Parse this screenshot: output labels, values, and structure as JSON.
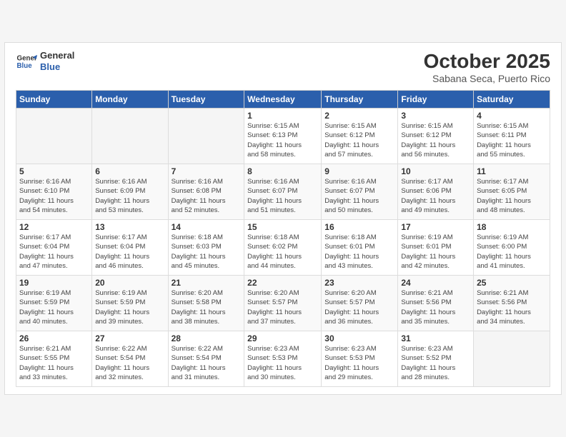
{
  "header": {
    "logo_line1": "General",
    "logo_line2": "Blue",
    "month": "October 2025",
    "location": "Sabana Seca, Puerto Rico"
  },
  "weekdays": [
    "Sunday",
    "Monday",
    "Tuesday",
    "Wednesday",
    "Thursday",
    "Friday",
    "Saturday"
  ],
  "weeks": [
    [
      {
        "day": "",
        "info": ""
      },
      {
        "day": "",
        "info": ""
      },
      {
        "day": "",
        "info": ""
      },
      {
        "day": "1",
        "info": "Sunrise: 6:15 AM\nSunset: 6:13 PM\nDaylight: 11 hours\nand 58 minutes."
      },
      {
        "day": "2",
        "info": "Sunrise: 6:15 AM\nSunset: 6:12 PM\nDaylight: 11 hours\nand 57 minutes."
      },
      {
        "day": "3",
        "info": "Sunrise: 6:15 AM\nSunset: 6:12 PM\nDaylight: 11 hours\nand 56 minutes."
      },
      {
        "day": "4",
        "info": "Sunrise: 6:15 AM\nSunset: 6:11 PM\nDaylight: 11 hours\nand 55 minutes."
      }
    ],
    [
      {
        "day": "5",
        "info": "Sunrise: 6:16 AM\nSunset: 6:10 PM\nDaylight: 11 hours\nand 54 minutes."
      },
      {
        "day": "6",
        "info": "Sunrise: 6:16 AM\nSunset: 6:09 PM\nDaylight: 11 hours\nand 53 minutes."
      },
      {
        "day": "7",
        "info": "Sunrise: 6:16 AM\nSunset: 6:08 PM\nDaylight: 11 hours\nand 52 minutes."
      },
      {
        "day": "8",
        "info": "Sunrise: 6:16 AM\nSunset: 6:07 PM\nDaylight: 11 hours\nand 51 minutes."
      },
      {
        "day": "9",
        "info": "Sunrise: 6:16 AM\nSunset: 6:07 PM\nDaylight: 11 hours\nand 50 minutes."
      },
      {
        "day": "10",
        "info": "Sunrise: 6:17 AM\nSunset: 6:06 PM\nDaylight: 11 hours\nand 49 minutes."
      },
      {
        "day": "11",
        "info": "Sunrise: 6:17 AM\nSunset: 6:05 PM\nDaylight: 11 hours\nand 48 minutes."
      }
    ],
    [
      {
        "day": "12",
        "info": "Sunrise: 6:17 AM\nSunset: 6:04 PM\nDaylight: 11 hours\nand 47 minutes."
      },
      {
        "day": "13",
        "info": "Sunrise: 6:17 AM\nSunset: 6:04 PM\nDaylight: 11 hours\nand 46 minutes."
      },
      {
        "day": "14",
        "info": "Sunrise: 6:18 AM\nSunset: 6:03 PM\nDaylight: 11 hours\nand 45 minutes."
      },
      {
        "day": "15",
        "info": "Sunrise: 6:18 AM\nSunset: 6:02 PM\nDaylight: 11 hours\nand 44 minutes."
      },
      {
        "day": "16",
        "info": "Sunrise: 6:18 AM\nSunset: 6:01 PM\nDaylight: 11 hours\nand 43 minutes."
      },
      {
        "day": "17",
        "info": "Sunrise: 6:19 AM\nSunset: 6:01 PM\nDaylight: 11 hours\nand 42 minutes."
      },
      {
        "day": "18",
        "info": "Sunrise: 6:19 AM\nSunset: 6:00 PM\nDaylight: 11 hours\nand 41 minutes."
      }
    ],
    [
      {
        "day": "19",
        "info": "Sunrise: 6:19 AM\nSunset: 5:59 PM\nDaylight: 11 hours\nand 40 minutes."
      },
      {
        "day": "20",
        "info": "Sunrise: 6:19 AM\nSunset: 5:59 PM\nDaylight: 11 hours\nand 39 minutes."
      },
      {
        "day": "21",
        "info": "Sunrise: 6:20 AM\nSunset: 5:58 PM\nDaylight: 11 hours\nand 38 minutes."
      },
      {
        "day": "22",
        "info": "Sunrise: 6:20 AM\nSunset: 5:57 PM\nDaylight: 11 hours\nand 37 minutes."
      },
      {
        "day": "23",
        "info": "Sunrise: 6:20 AM\nSunset: 5:57 PM\nDaylight: 11 hours\nand 36 minutes."
      },
      {
        "day": "24",
        "info": "Sunrise: 6:21 AM\nSunset: 5:56 PM\nDaylight: 11 hours\nand 35 minutes."
      },
      {
        "day": "25",
        "info": "Sunrise: 6:21 AM\nSunset: 5:56 PM\nDaylight: 11 hours\nand 34 minutes."
      }
    ],
    [
      {
        "day": "26",
        "info": "Sunrise: 6:21 AM\nSunset: 5:55 PM\nDaylight: 11 hours\nand 33 minutes."
      },
      {
        "day": "27",
        "info": "Sunrise: 6:22 AM\nSunset: 5:54 PM\nDaylight: 11 hours\nand 32 minutes."
      },
      {
        "day": "28",
        "info": "Sunrise: 6:22 AM\nSunset: 5:54 PM\nDaylight: 11 hours\nand 31 minutes."
      },
      {
        "day": "29",
        "info": "Sunrise: 6:23 AM\nSunset: 5:53 PM\nDaylight: 11 hours\nand 30 minutes."
      },
      {
        "day": "30",
        "info": "Sunrise: 6:23 AM\nSunset: 5:53 PM\nDaylight: 11 hours\nand 29 minutes."
      },
      {
        "day": "31",
        "info": "Sunrise: 6:23 AM\nSunset: 5:52 PM\nDaylight: 11 hours\nand 28 minutes."
      },
      {
        "day": "",
        "info": ""
      }
    ]
  ]
}
